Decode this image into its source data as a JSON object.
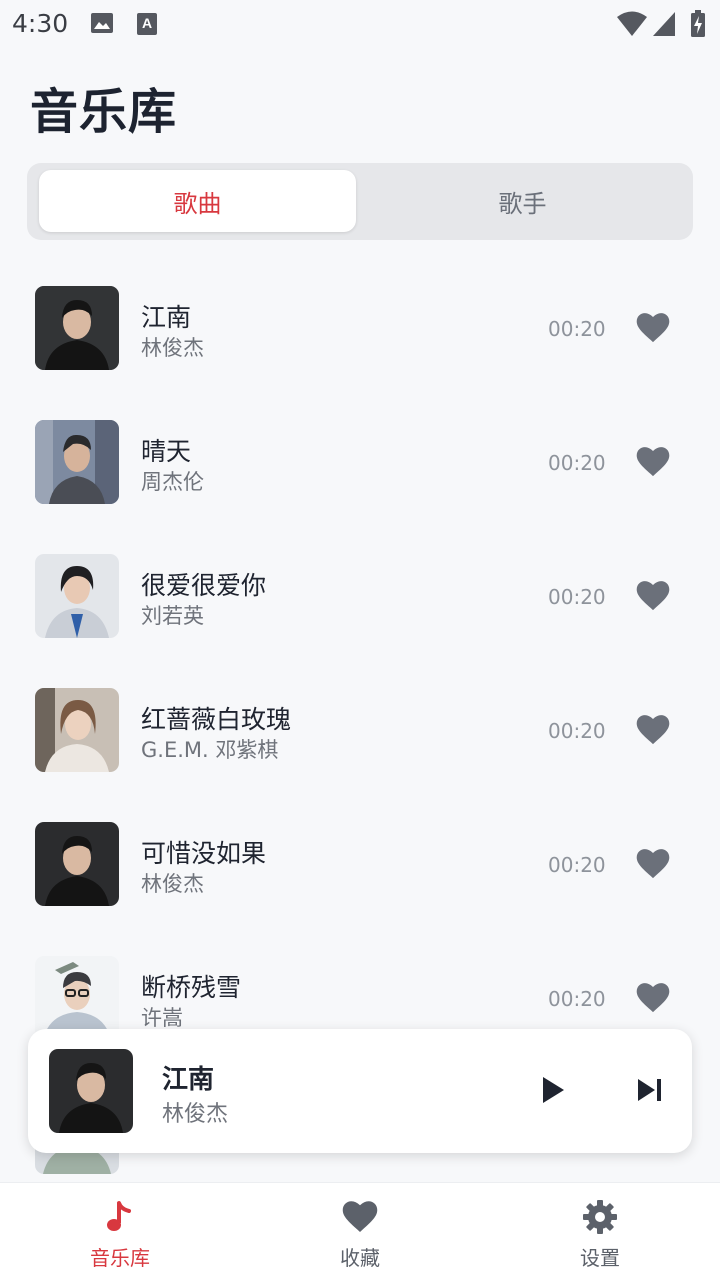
{
  "status_bar": {
    "time": "4:30"
  },
  "title": "音乐库",
  "segments": {
    "active": "歌曲",
    "inactive": "歌手"
  },
  "songs": [
    {
      "title": "江南",
      "artist": "林俊杰",
      "duration": "00:20"
    },
    {
      "title": "晴天",
      "artist": "周杰伦",
      "duration": "00:20"
    },
    {
      "title": "很爱很爱你",
      "artist": "刘若英",
      "duration": "00:20"
    },
    {
      "title": "红蔷薇白玫瑰",
      "artist": "G.E.M. 邓紫棋",
      "duration": "00:20"
    },
    {
      "title": "可惜没如果",
      "artist": "林俊杰",
      "duration": "00:20"
    },
    {
      "title": "断桥残雪",
      "artist": "许嵩",
      "duration": "00:20"
    }
  ],
  "now_playing": {
    "title": "江南",
    "artist": "林俊杰"
  },
  "bottom_nav": [
    {
      "label": "音乐库",
      "icon": "music-note-icon",
      "active": true
    },
    {
      "label": "收藏",
      "icon": "heart-icon",
      "active": false
    },
    {
      "label": "设置",
      "icon": "gear-icon",
      "active": false
    }
  ],
  "colors": {
    "accent": "#d8383f",
    "heart": "#6b707a",
    "background": "#f7f8fa",
    "segment_bg": "#e6e7ea"
  }
}
